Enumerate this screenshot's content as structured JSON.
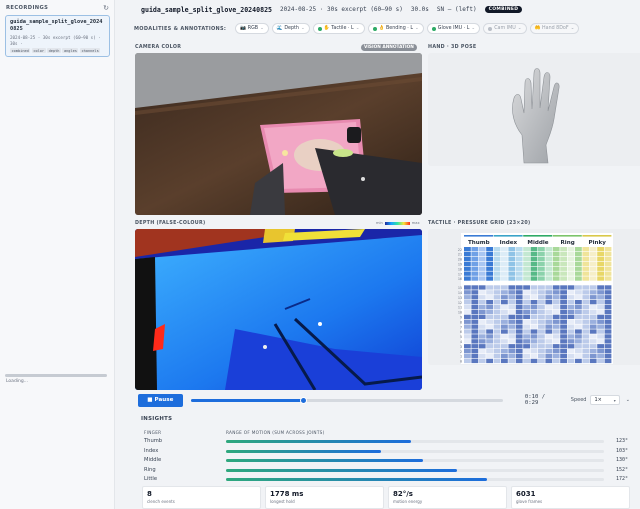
{
  "sidebar": {
    "title": "RECORDINGS",
    "recording": {
      "name": "guida_sample_split_glove_20240825",
      "meta": "2024-08-25 · 30s excerpt (60–90 s) · 30s ·",
      "tags": [
        "combined",
        "color",
        "depth",
        "angles",
        "channels"
      ]
    },
    "status": "Loading..."
  },
  "header": {
    "title": "guida_sample_split_glove_20240825",
    "meta1": "2024-08-25 · 30s excerpt (60–90 s)",
    "meta2": "30.0s",
    "meta3": "SN — (left)",
    "badge": "COMBINED"
  },
  "modalities": {
    "label": "MODALITIES & ANNOTATIONS:",
    "chips": [
      {
        "label": "📷 RGB",
        "on": true,
        "color": ""
      },
      {
        "label": "🌊 Depth",
        "on": true,
        "color": ""
      },
      {
        "label": "✋ Tactile · L",
        "on": true,
        "color": "#2eaa66"
      },
      {
        "label": "👌 Bending · L",
        "on": true,
        "color": "#2eaa66"
      },
      {
        "label": "Glove IMU · L",
        "on": true,
        "color": "#2eaa66"
      },
      {
        "label": "Cam IMU",
        "on": false,
        "color": "#b9bec6"
      },
      {
        "label": "🤲 Hand 8DoF",
        "on": false,
        "color": "#b9bec6"
      }
    ]
  },
  "panels": {
    "camera": "CAMERA COLOR",
    "vision_badge": "VISION ANNOTATION",
    "hand": "HAND · 3D POSE",
    "depth": "DEPTH (FALSE-COLOUR)",
    "tactile": "TACTILE · PRESSURE GRID (23×20)",
    "legend_min": "min",
    "legend_max": "max"
  },
  "tactile": {
    "fingers": [
      "Thumb",
      "Index",
      "Middle",
      "Ring",
      "Pinky"
    ],
    "finger_colors": [
      "#3a7bd5",
      "#3aa3c8",
      "#2eaa66",
      "#7cc46a",
      "#d9c84a"
    ],
    "row_numbers": [
      "22",
      "21",
      "20",
      "19",
      "18",
      "17",
      "16",
      "15",
      "14",
      "13",
      "12",
      "11",
      "10",
      "9",
      "8",
      "7",
      "6",
      "5",
      "4",
      "3",
      "2",
      "1",
      "0"
    ]
  },
  "playback": {
    "pause_label": "Pause",
    "progress": 0.36,
    "time": "0:10 / 0:29",
    "speed_label": "Speed",
    "speed_value": "1×"
  },
  "insights": {
    "title": "INSIGHTS",
    "col_finger": "FINGER",
    "col_rom": "RANGE OF MOTION (SUM ACROSS JOINTS)",
    "rows": [
      {
        "name": "Thumb",
        "value": "123°",
        "fraction": 0.49
      },
      {
        "name": "Index",
        "value": "103°",
        "fraction": 0.41
      },
      {
        "name": "Middle",
        "value": "130°",
        "fraction": 0.52
      },
      {
        "name": "Ring",
        "value": "152°",
        "fraction": 0.61
      },
      {
        "name": "Little",
        "value": "172°",
        "fraction": 0.69
      }
    ],
    "stats": [
      {
        "value": "8",
        "label": "clench events"
      },
      {
        "value": "1778 ms",
        "label": "longest hold"
      },
      {
        "value": "82°/s",
        "label": "motion energy"
      },
      {
        "value": "6031",
        "label": "glove frames"
      }
    ]
  }
}
